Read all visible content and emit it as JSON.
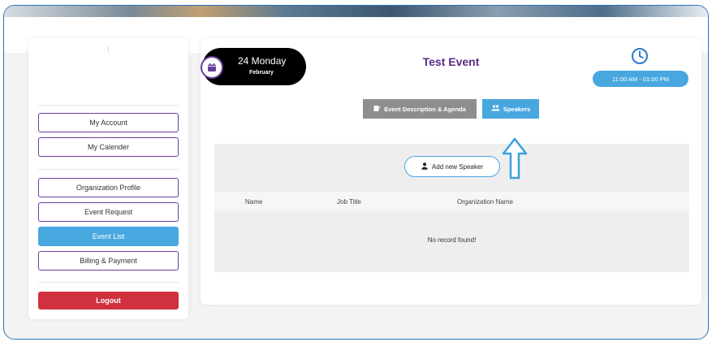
{
  "sidebar": {
    "items": [
      {
        "label": "My Account"
      },
      {
        "label": "My Calender"
      },
      {
        "label": "Organization Profile"
      },
      {
        "label": "Event Request"
      },
      {
        "label": "Event List"
      },
      {
        "label": "Billing & Payment"
      }
    ],
    "logout_label": "Logout",
    "active_item": "Event List"
  },
  "event": {
    "day": "24 Monday",
    "month": "February",
    "title": "Test Event",
    "time": "11:00 AM - 01:00 PM"
  },
  "tabs": [
    {
      "label": "Event Description & Agenda",
      "icon": "edit-icon"
    },
    {
      "label": "Speakers",
      "icon": "users-icon"
    }
  ],
  "speakers": {
    "add_label": "Add new Speaker",
    "columns": [
      "Name",
      "Job Title",
      "Organization Name"
    ],
    "empty_message": "No record found!"
  },
  "colors": {
    "brand_purple": "#6a3d9a",
    "accent_blue": "#49a7e0",
    "logout_red": "#d1313f",
    "tab_gray": "#8e8e8e"
  }
}
